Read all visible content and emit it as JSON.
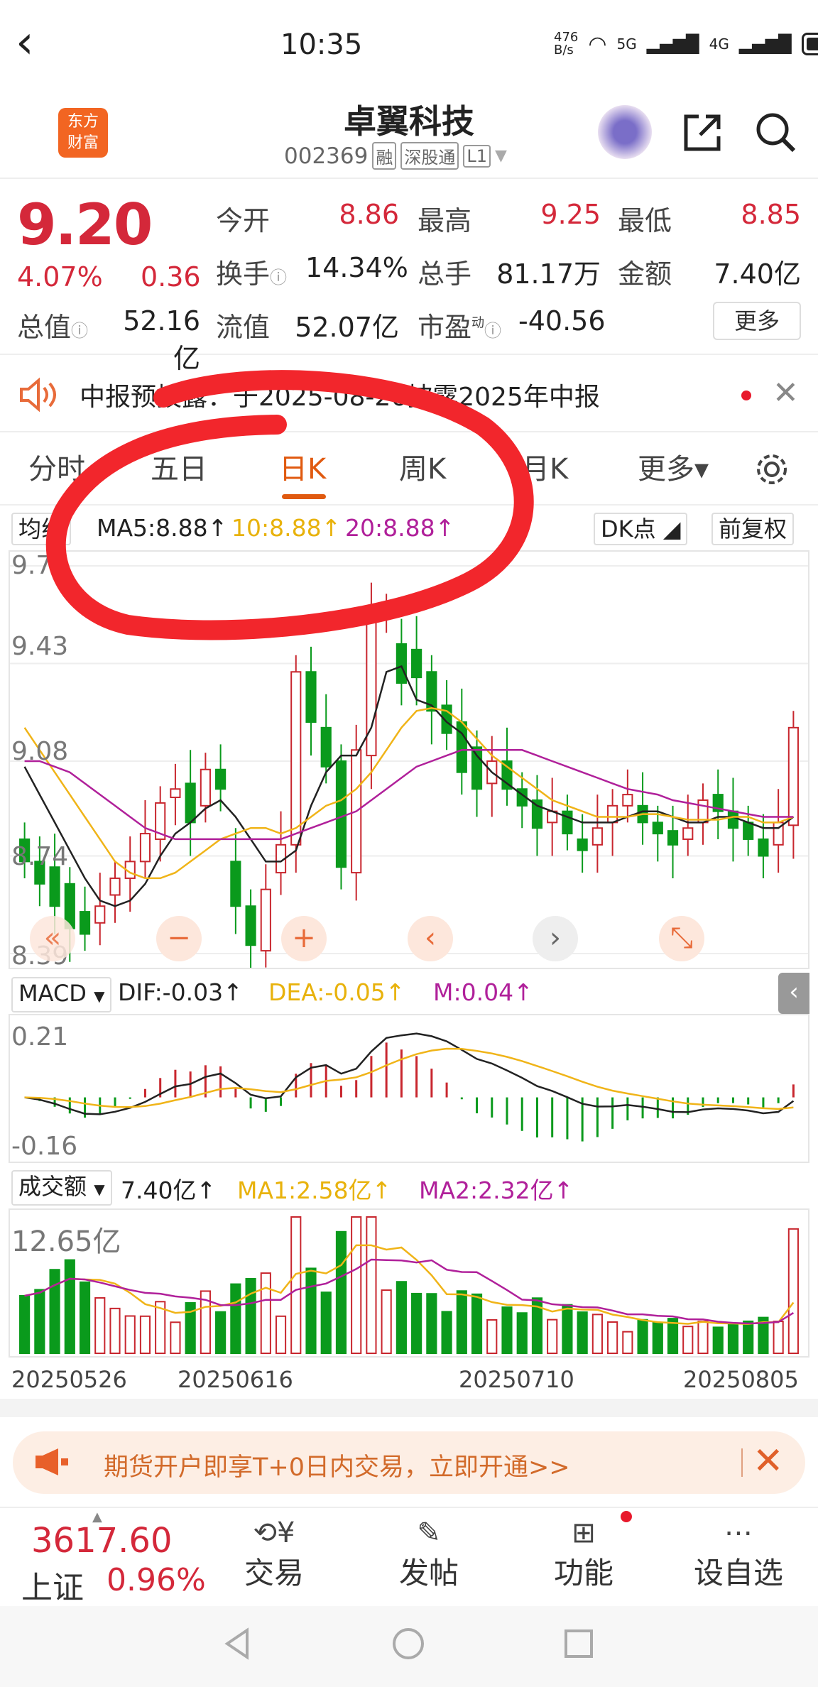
{
  "status": {
    "time": "10:35",
    "net_speed": "476\nB/s",
    "net1": "5G",
    "net2": "4G"
  },
  "header": {
    "logo_text": "东方\n财富",
    "stock_name": "卓翼科技",
    "code": "002369",
    "tags": [
      "融",
      "深股通",
      "L1"
    ]
  },
  "quote": {
    "price": "9.20",
    "change_pct": "4.07%",
    "change": "0.36",
    "open_label": "今开",
    "open": "8.86",
    "high_label": "最高",
    "high": "9.25",
    "low_label": "最低",
    "low": "8.85",
    "turnover_label": "换手",
    "turnover": "14.34%",
    "volume_label": "总手",
    "volume": "81.17万",
    "amount_label": "金额",
    "amount": "7.40亿",
    "mcap_label": "总值",
    "mcap": "52.16亿",
    "float_label": "流值",
    "float": "52.07亿",
    "pe_label": "市盈",
    "pe_sup": "动",
    "pe": "-40.56",
    "more": "更多"
  },
  "notice": {
    "text": "中报预披露：于2025-08-26披露2025年中报"
  },
  "tabs": [
    "分时",
    "五日",
    "日K",
    "周K",
    "月K",
    "更多▾"
  ],
  "kline": {
    "ma_type": "均线",
    "ma5": "MA5:8.88↑",
    "ma10": "10:8.88↑",
    "ma20": "20:8.88↑",
    "dk": "DK点",
    "adjust": "前复权",
    "y_labels": [
      "9.78",
      "9.43",
      "9.08",
      "8.74",
      "8.39"
    ]
  },
  "macd": {
    "label": "MACD",
    "dif": "DIF:-0.03↑",
    "dea": "DEA:-0.05↑",
    "m": "M:0.04↑",
    "y_top": "0.21",
    "y_bottom": "-0.16"
  },
  "volume": {
    "label": "成交额",
    "value": "7.40亿↑",
    "ma1": "MA1:2.58亿↑",
    "ma2": "MA2:2.32亿↑",
    "y_top": "12.65亿"
  },
  "x_labels": [
    "20250526",
    "20250616",
    "20250710",
    "20250805"
  ],
  "ad": {
    "text": "期货开户即享T+0日内交易，立即开通>>"
  },
  "bottom": {
    "index_value": "3617.60",
    "index_name": "上证",
    "index_pct": "0.96%",
    "trade": "交易",
    "post": "发帖",
    "func": "功能",
    "watch": "设自选"
  },
  "chart_data": {
    "type": "candlestick",
    "dates": [
      "20250526",
      "20250527",
      "20250528",
      "20250529",
      "20250530",
      "20250603",
      "20250604",
      "20250605",
      "20250606",
      "20250609",
      "20250610",
      "20250611",
      "20250612",
      "20250613",
      "20250616",
      "20250617",
      "20250618",
      "20250619",
      "20250620",
      "20250623",
      "20250624",
      "20250625",
      "20250626",
      "20250627",
      "20250630",
      "20250701",
      "20250702",
      "20250703",
      "20250704",
      "20250707",
      "20250708",
      "20250709",
      "20250710",
      "20250711",
      "20250714",
      "20250715",
      "20250716",
      "20250717",
      "20250718",
      "20250721",
      "20250722",
      "20250723",
      "20250724",
      "20250725",
      "20250728",
      "20250729",
      "20250730",
      "20250731",
      "20250801",
      "20250804",
      "20250805",
      "20250806"
    ],
    "open": [
      8.8,
      8.72,
      8.7,
      8.64,
      8.54,
      8.5,
      8.6,
      8.66,
      8.72,
      8.8,
      8.95,
      9.0,
      8.92,
      9.05,
      8.72,
      8.56,
      8.4,
      8.68,
      8.78,
      9.4,
      9.2,
      9.08,
      8.68,
      9.1,
      9.6,
      9.5,
      9.48,
      9.4,
      9.28,
      9.22,
      9.13,
      9.0,
      9.08,
      8.98,
      8.94,
      8.86,
      8.9,
      8.8,
      8.78,
      8.86,
      8.92,
      8.92,
      8.86,
      8.83,
      8.8,
      8.86,
      8.96,
      8.9,
      8.86,
      8.8,
      8.78,
      8.85
    ],
    "close": [
      8.72,
      8.64,
      8.56,
      8.48,
      8.46,
      8.56,
      8.66,
      8.72,
      8.82,
      8.93,
      8.98,
      8.86,
      9.05,
      8.98,
      8.56,
      8.42,
      8.62,
      8.78,
      9.4,
      9.22,
      9.06,
      8.7,
      9.12,
      9.6,
      9.62,
      9.36,
      9.38,
      9.26,
      9.18,
      9.04,
      8.98,
      9.08,
      8.98,
      8.92,
      8.84,
      8.9,
      8.82,
      8.76,
      8.84,
      8.92,
      8.96,
      8.86,
      8.82,
      8.78,
      8.84,
      8.94,
      8.9,
      8.84,
      8.8,
      8.74,
      8.86,
      9.2
    ],
    "ma5": [
      9.06,
      8.96,
      8.86,
      8.76,
      8.66,
      8.58,
      8.56,
      8.58,
      8.64,
      8.74,
      8.82,
      8.86,
      8.91,
      8.94,
      8.88,
      8.8,
      8.72,
      8.72,
      8.76,
      8.92,
      9.04,
      9.1,
      9.1,
      9.2,
      9.4,
      9.42,
      9.3,
      9.28,
      9.22,
      9.18,
      9.1,
      9.04,
      9.0,
      8.96,
      8.92,
      8.9,
      8.88,
      8.86,
      8.86,
      8.86,
      8.88,
      8.9,
      8.9,
      8.88,
      8.86,
      8.86,
      8.88,
      8.88,
      8.86,
      8.84,
      8.84,
      8.88
    ],
    "ma10": [
      9.2,
      9.12,
      9.04,
      8.96,
      8.88,
      8.8,
      8.72,
      8.68,
      8.66,
      8.66,
      8.68,
      8.72,
      8.76,
      8.8,
      8.82,
      8.84,
      8.84,
      8.82,
      8.84,
      8.88,
      8.92,
      8.94,
      8.98,
      9.04,
      9.12,
      9.2,
      9.26,
      9.27,
      9.26,
      9.22,
      9.16,
      9.1,
      9.06,
      9.02,
      8.98,
      8.94,
      8.92,
      8.9,
      8.88,
      8.88,
      8.88,
      8.89,
      8.89,
      8.88,
      8.87,
      8.87,
      8.87,
      8.88,
      8.88,
      8.86,
      8.86,
      8.88
    ],
    "ma20": [
      9.08,
      9.08,
      9.06,
      9.04,
      9.0,
      8.96,
      8.92,
      8.88,
      8.84,
      8.82,
      8.8,
      8.8,
      8.8,
      8.8,
      8.8,
      8.8,
      8.8,
      8.8,
      8.82,
      8.84,
      8.86,
      8.88,
      8.9,
      8.94,
      8.98,
      9.02,
      9.06,
      9.08,
      9.1,
      9.12,
      9.12,
      9.12,
      9.12,
      9.12,
      9.1,
      9.08,
      9.06,
      9.04,
      9.02,
      9.0,
      8.98,
      8.97,
      8.96,
      8.94,
      8.93,
      8.92,
      8.91,
      8.9,
      8.89,
      8.88,
      8.88,
      8.88
    ],
    "macd_range": [
      -0.16,
      0.21
    ],
    "volume_unit": "亿",
    "volume_max": 12.65
  }
}
